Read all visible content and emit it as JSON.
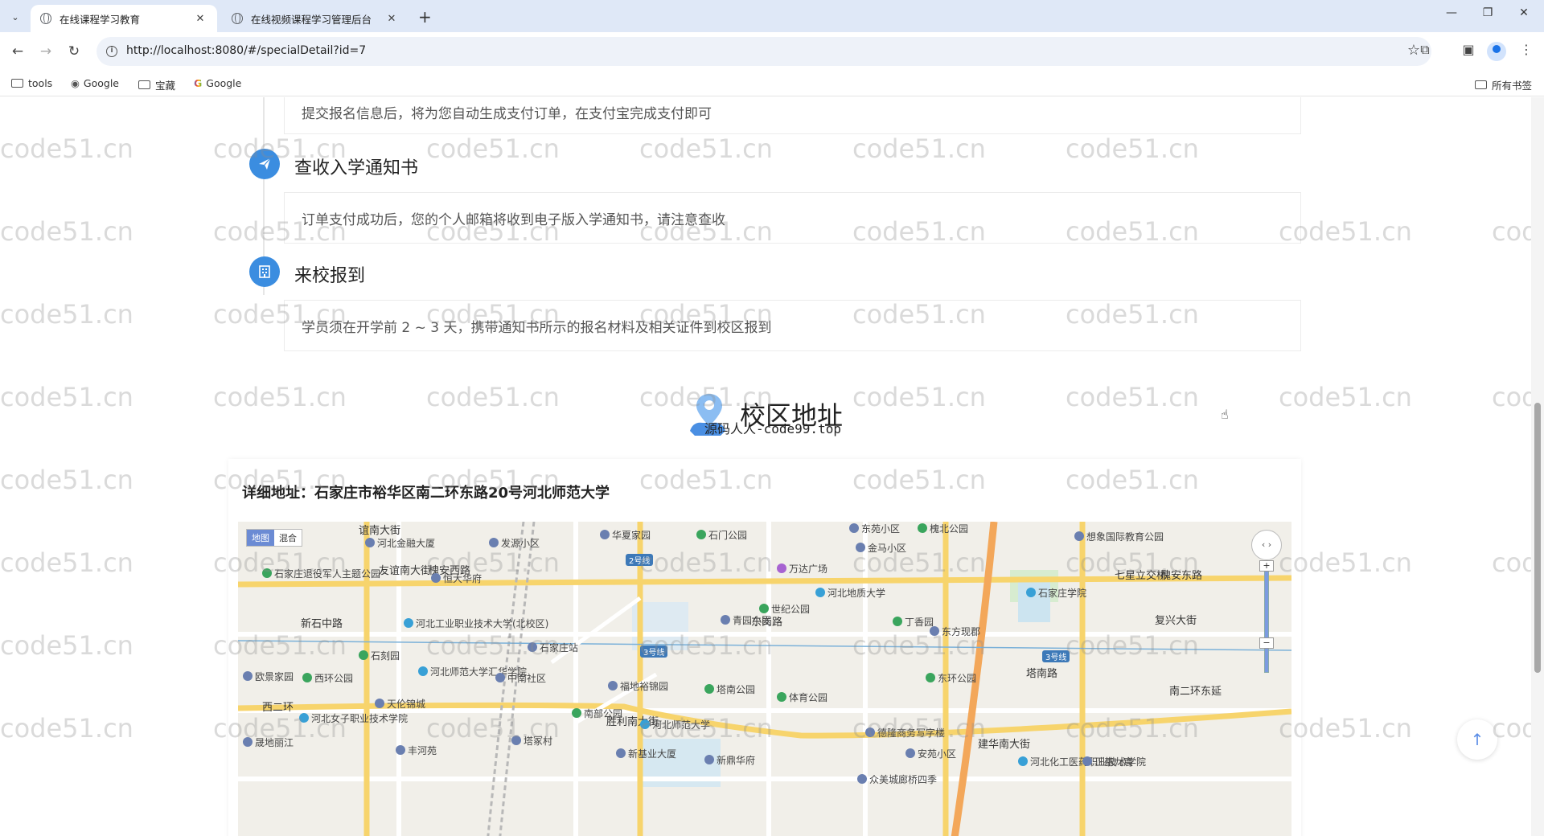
{
  "browser": {
    "tabs": [
      {
        "title": "在线课程学习教育",
        "active": true
      },
      {
        "title": "在线视频课程学习管理后台",
        "active": false
      }
    ],
    "url": "http://localhost:8080/#/specialDetail?id=7",
    "bookmarks": [
      "tools",
      "Google",
      "宝藏",
      "Google"
    ],
    "bookmarks_right": "所有书签"
  },
  "steps": [
    {
      "title": "",
      "desc": "提交报名信息后，将为您自动生成支付订单，在支付宝完成支付即可",
      "icon": "payment-icon"
    },
    {
      "title": "查收入学通知书",
      "desc": "订单支付成功后，您的个人邮箱将收到电子版入学通知书，请注意查收",
      "icon": "paper-plane-icon"
    },
    {
      "title": "来校报到",
      "desc": "学员须在开学前 2 ~ 3 天，携带通知书所示的报名材料及相关证件到校区报到",
      "icon": "building-icon"
    }
  ],
  "campus": {
    "title": "校区地址",
    "inline_watermark": "源码人人-code99.top",
    "address_label": "详细地址：石家庄市裕华区南二环东路20号河北师范大学"
  },
  "map": {
    "type_buttons": [
      "地图",
      "混合"
    ],
    "labels": [
      {
        "text": "槐安西路",
        "kind": "road"
      },
      {
        "text": "槐安东路",
        "kind": "road"
      },
      {
        "text": "新石中路",
        "kind": "road"
      },
      {
        "text": "东岗路",
        "kind": "road"
      },
      {
        "text": "塔南路",
        "kind": "road"
      },
      {
        "text": "南二环东延",
        "kind": "road"
      },
      {
        "text": "七星立交桥",
        "kind": "road"
      },
      {
        "text": "谊南大街",
        "kind": "road"
      },
      {
        "text": "友谊南大街",
        "kind": "road"
      },
      {
        "text": "胜利南大街",
        "kind": "road"
      },
      {
        "text": "建华南大街",
        "kind": "road"
      },
      {
        "text": "复兴大街",
        "kind": "road"
      },
      {
        "text": "西二环",
        "kind": "road"
      },
      {
        "text": "河北金融大厦",
        "kind": "poi"
      },
      {
        "text": "发源小区",
        "kind": "poi"
      },
      {
        "text": "华夏家园",
        "kind": "poi"
      },
      {
        "text": "石门公园",
        "kind": "park"
      },
      {
        "text": "东苑小区",
        "kind": "poi"
      },
      {
        "text": "槐北公园",
        "kind": "park"
      },
      {
        "text": "金马小区",
        "kind": "poi"
      },
      {
        "text": "想象国际教育公园",
        "kind": "poi"
      },
      {
        "text": "石家庄退役军人主题公园",
        "kind": "park"
      },
      {
        "text": "恒大华府",
        "kind": "poi"
      },
      {
        "text": "万达广场",
        "kind": "mall"
      },
      {
        "text": "河北地质大学",
        "kind": "school"
      },
      {
        "text": "石家庄学院",
        "kind": "school"
      },
      {
        "text": "世纪公园",
        "kind": "park"
      },
      {
        "text": "青园小区",
        "kind": "poi"
      },
      {
        "text": "丁香园",
        "kind": "park"
      },
      {
        "text": "东方现郡",
        "kind": "poi"
      },
      {
        "text": "河北工业职业技术大学(北校区)",
        "kind": "school"
      },
      {
        "text": "石家庄站",
        "kind": "poi"
      },
      {
        "text": "石刻园",
        "kind": "park"
      },
      {
        "text": "西环公园",
        "kind": "park"
      },
      {
        "text": "欧景家园",
        "kind": "poi"
      },
      {
        "text": "河北师范大学汇华学院",
        "kind": "school"
      },
      {
        "text": "中南社区",
        "kind": "poi"
      },
      {
        "text": "福地裕锦园",
        "kind": "poi"
      },
      {
        "text": "塔南公园",
        "kind": "park"
      },
      {
        "text": "体育公园",
        "kind": "park"
      },
      {
        "text": "东环公园",
        "kind": "park"
      },
      {
        "text": "天伦锦城",
        "kind": "poi"
      },
      {
        "text": "南部公园",
        "kind": "park"
      },
      {
        "text": "河北师范大学",
        "kind": "school"
      },
      {
        "text": "河北女子职业技术学院",
        "kind": "school"
      },
      {
        "text": "晟地丽江",
        "kind": "poi"
      },
      {
        "text": "塔冢村",
        "kind": "poi"
      },
      {
        "text": "丰河苑",
        "kind": "poi"
      },
      {
        "text": "新基业大厦",
        "kind": "poi"
      },
      {
        "text": "新鼎华府",
        "kind": "poi"
      },
      {
        "text": "德隆商务写字楼",
        "kind": "poi"
      },
      {
        "text": "安苑小区",
        "kind": "poi"
      },
      {
        "text": "河北化工医药职业技术学院",
        "kind": "school"
      },
      {
        "text": "正基九宸",
        "kind": "poi"
      },
      {
        "text": "众美城廊桥四季",
        "kind": "poi"
      },
      {
        "text": "2号线",
        "kind": "metro"
      },
      {
        "text": "3号线",
        "kind": "metro"
      },
      {
        "text": "3号线",
        "kind": "metro"
      }
    ]
  },
  "watermark": "code51.cn",
  "colors": {
    "accent": "#3b8de0",
    "timeline": "#e6e6e6"
  }
}
